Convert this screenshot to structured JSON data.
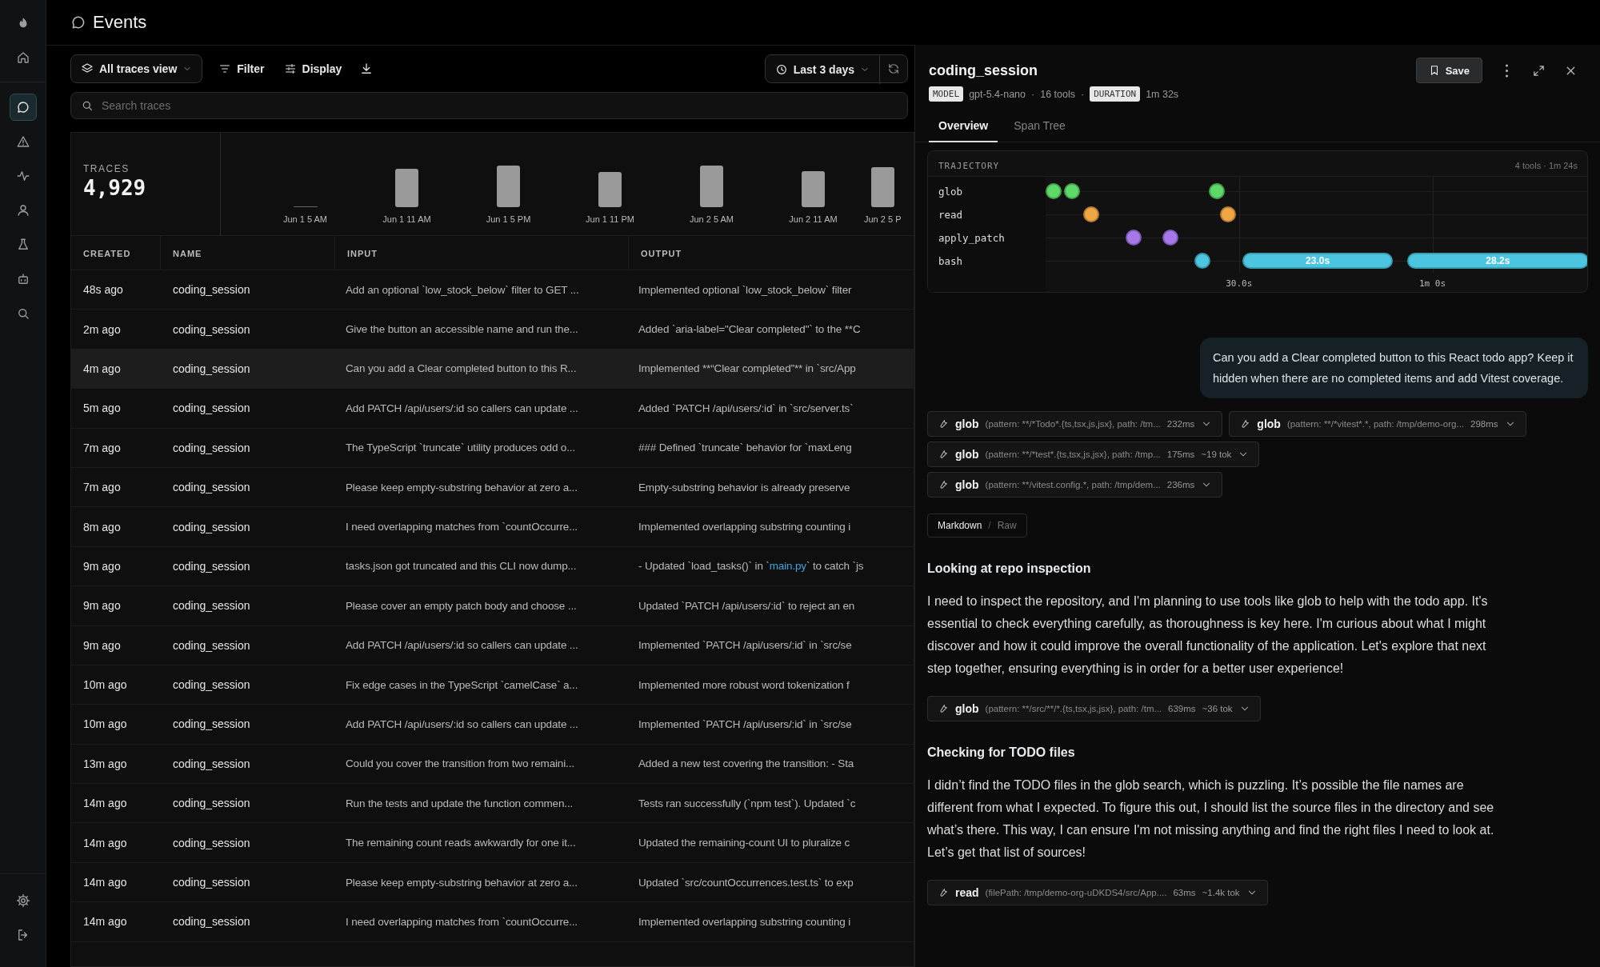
{
  "sidebar": {
    "items": [
      {
        "kind": "logo",
        "selected": false
      },
      {
        "kind": "home",
        "selected": false
      },
      {
        "kind": "chat",
        "selected": true
      },
      {
        "kind": "warning",
        "selected": false
      },
      {
        "kind": "activity",
        "selected": false
      },
      {
        "kind": "user",
        "selected": false
      },
      {
        "kind": "flask",
        "selected": false
      },
      {
        "kind": "bot",
        "selected": false
      },
      {
        "kind": "search",
        "selected": false
      }
    ],
    "bottom_items": [
      {
        "kind": "settings",
        "selected": false
      },
      {
        "kind": "logout",
        "selected": false
      }
    ]
  },
  "page": {
    "title": "Events"
  },
  "toolbar": {
    "view": "All traces view",
    "filter": "Filter",
    "display": "Display",
    "range": "Last 3 days"
  },
  "search": {
    "placeholder": "Search traces"
  },
  "stats": {
    "label": "TRACES",
    "value": "4,929"
  },
  "histogram": {
    "labels": [
      "Jun 1 5 AM",
      "Jun 1 11 AM",
      "Jun 1 5 PM",
      "Jun 1 11 PM",
      "Jun 2 5 AM",
      "Jun 2 11 AM",
      "Jun 2 5 P"
    ]
  },
  "table": {
    "columns": [
      "CREATED",
      "NAME",
      "INPUT",
      "OUTPUT"
    ],
    "rows": [
      {
        "created": "48s ago",
        "name": "coding_session",
        "input": "Add an optional `low_stock_below` filter to GET ...",
        "output": "Implemented optional `low_stock_below` filter",
        "selected": false
      },
      {
        "created": "2m ago",
        "name": "coding_session",
        "input": "Give the button an accessible name and run the...",
        "output": "Added `aria-label=\"Clear completed\"` to the **C",
        "selected": false
      },
      {
        "created": "4m ago",
        "name": "coding_session",
        "input": "Can you add a Clear completed button to this R...",
        "output": "Implemented **“Clear completed”** in `src/App",
        "selected": true
      },
      {
        "created": "5m ago",
        "name": "coding_session",
        "input": "Add PATCH /api/users/:id so callers can update ...",
        "output": "Added `PATCH /api/users/:id` in `src/server.ts`",
        "selected": false
      },
      {
        "created": "7m ago",
        "name": "coding_session",
        "input": "The TypeScript `truncate` utility produces odd o...",
        "output": "### Defined `truncate` behavior for `maxLeng",
        "selected": false
      },
      {
        "created": "7m ago",
        "name": "coding_session",
        "input": "Please keep empty-substring behavior at zero a...",
        "output": "Empty-substring behavior is already preserve",
        "selected": false
      },
      {
        "created": "8m ago",
        "name": "coding_session",
        "input": "I need overlapping matches from `countOccurre...",
        "output": "Implemented overlapping substring counting i",
        "selected": false
      },
      {
        "created": "9m ago",
        "name": "coding_session",
        "input": "tasks.json got truncated and this CLI now dump...",
        "output": "- Updated `load_tasks()` in `",
        "output_link": "main.py",
        "output_after": "` to catch `js",
        "selected": false
      },
      {
        "created": "9m ago",
        "name": "coding_session",
        "input": "Please cover an empty patch body and choose ...",
        "output": "Updated `PATCH /api/users/:id` to reject an en",
        "selected": false
      },
      {
        "created": "9m ago",
        "name": "coding_session",
        "input": "Add PATCH /api/users/:id so callers can update ...",
        "output": "Implemented `PATCH /api/users/:id` in `src/se",
        "selected": false
      },
      {
        "created": "10m ago",
        "name": "coding_session",
        "input": "Fix edge cases in the TypeScript `camelCase` a...",
        "output": "Implemented more robust word tokenization f",
        "selected": false
      },
      {
        "created": "10m ago",
        "name": "coding_session",
        "input": "Add PATCH /api/users/:id so callers can update ...",
        "output": "Implemented `PATCH /api/users/:id` in `src/se",
        "selected": false
      },
      {
        "created": "13m ago",
        "name": "coding_session",
        "input": "Could you cover the transition from two remaini...",
        "output": "Added a new test covering the transition: - Sta",
        "selected": false
      },
      {
        "created": "14m ago",
        "name": "coding_session",
        "input": "Run the tests and update the function commen...",
        "output": "Tests ran successfully (`npm test`). Updated `c",
        "selected": false
      },
      {
        "created": "14m ago",
        "name": "coding_session",
        "input": "The remaining count reads awkwardly for one it...",
        "output": "Updated the remaining-count UI to pluralize c",
        "selected": false
      },
      {
        "created": "14m ago",
        "name": "coding_session",
        "input": "Please keep empty-substring behavior at zero a...",
        "output": "Updated `src/countOccurrences.test.ts` to exp",
        "selected": false
      },
      {
        "created": "14m ago",
        "name": "coding_session",
        "input": "I need overlapping matches from `countOccurre...",
        "output": "Implemented overlapping substring counting i",
        "selected": false
      }
    ]
  },
  "detail": {
    "title": "coding_session",
    "meta": [
      {
        "kind": "badge",
        "text": "MODEL"
      },
      {
        "kind": "text",
        "text": "gpt-5.4-nano"
      },
      {
        "kind": "sep",
        "text": "·"
      },
      {
        "kind": "text",
        "text": "16 tools"
      },
      {
        "kind": "sep",
        "text": "·"
      },
      {
        "kind": "badge",
        "text": "DURATION"
      },
      {
        "kind": "text",
        "text": "1m 32s"
      }
    ],
    "save": "Save",
    "tabs": [
      {
        "label": "Overview",
        "selected": true
      },
      {
        "label": "Span Tree",
        "selected": false
      }
    ],
    "trajectory": {
      "title": "TRAJECTORY",
      "summary": "4 tools · 1m 24s",
      "rows": [
        {
          "name": "glob",
          "color": "#5fd86a"
        },
        {
          "name": "read",
          "color": "#f0a645"
        },
        {
          "name": "apply_patch",
          "color": "#a678ea"
        },
        {
          "name": "bash",
          "color": "#4cc6e0"
        }
      ],
      "bar_labels": [
        "23.0s",
        "28.2s"
      ],
      "ticks": [
        "30.0s",
        "1m 0s"
      ]
    },
    "blocks": [
      {
        "kind": "user",
        "text": "Can you add a Clear completed button to this React todo app? Keep it hidden when there are no completed items and add Vitest coverage."
      },
      {
        "kind": "tools",
        "rows": [
          [
            {
              "tool": "glob",
              "args": "(pattern: **/*Todo*.{ts,tsx,js,jsx}, path: /tm...",
              "duration": "232ms"
            },
            {
              "tool": "glob",
              "args": "(pattern: **/*vitest*.*, path: /tmp/demo-org...",
              "duration": "298ms"
            }
          ],
          [
            {
              "tool": "glob",
              "args": "(pattern: **/*test*.{ts,tsx,js,jsx}, path: /tmp...",
              "duration": "175ms",
              "tokens": "~19 tok"
            }
          ],
          [
            {
              "tool": "glob",
              "args": "(pattern: **/vitest.config.*, path: /tmp/dem...",
              "duration": "236ms"
            }
          ]
        ]
      },
      {
        "kind": "toggle",
        "separator": "/",
        "options": [
          {
            "label": "Markdown",
            "selected": true
          },
          {
            "label": "Raw",
            "selected": false
          }
        ]
      },
      {
        "kind": "heading",
        "text": "Looking at repo inspection"
      },
      {
        "kind": "paragraph",
        "text": "I need to inspect the repository, and I'm planning to use tools like glob to help with the todo app. It's essential to check everything carefully, as thoroughness is key here. I'm curious about what I might discover and how it could improve the overall functionality of the application. Let's explore that next step together, ensuring everything is in order for a better user experience!"
      },
      {
        "kind": "tools",
        "rows": [
          [
            {
              "tool": "glob",
              "args": "(pattern: **/src/**/*.{ts,tsx,js,jsx}, path: /tm...",
              "duration": "639ms",
              "tokens": "~36 tok"
            }
          ]
        ]
      },
      {
        "kind": "heading",
        "text": "Checking for TODO files"
      },
      {
        "kind": "paragraph",
        "text": "I didn’t find the TODO files in the glob search, which is puzzling. It’s possible the file names are different from what I expected. To figure this out, I should list the source files in the directory and see what’s there. This way, I can ensure I'm not missing anything and find the right files I need to look at. Let’s get that list of sources!"
      },
      {
        "kind": "tools",
        "rows": [
          [
            {
              "tool": "read",
              "args": "(filePath: /tmp/demo-org-uDKDS4/src/App....",
              "duration": "63ms",
              "tokens": "~1.4k tok"
            }
          ]
        ]
      }
    ]
  }
}
